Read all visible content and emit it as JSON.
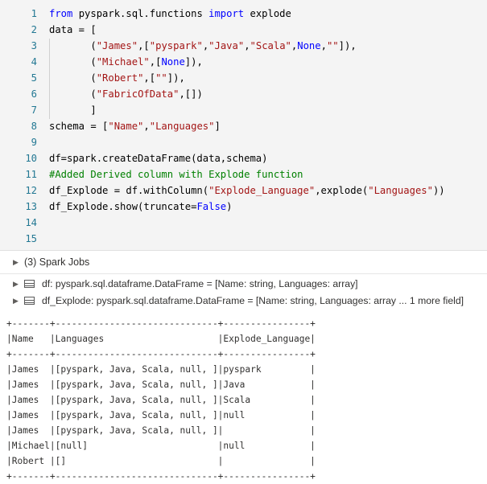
{
  "code_lines": [
    {
      "n": "1",
      "segs": [
        {
          "t": "from",
          "c": "kw"
        },
        {
          "t": " pyspark.sql.functions ",
          "c": "plain"
        },
        {
          "t": "import",
          "c": "kw"
        },
        {
          "t": " explode",
          "c": "plain"
        }
      ]
    },
    {
      "n": "2",
      "segs": [
        {
          "t": "data = [",
          "c": "plain"
        }
      ]
    },
    {
      "n": "3",
      "segs": [
        {
          "t": "       (",
          "c": "plain"
        },
        {
          "t": "\"James\"",
          "c": "str"
        },
        {
          "t": ",[",
          "c": "plain"
        },
        {
          "t": "\"pyspark\"",
          "c": "str"
        },
        {
          "t": ",",
          "c": "plain"
        },
        {
          "t": "\"Java\"",
          "c": "str"
        },
        {
          "t": ",",
          "c": "plain"
        },
        {
          "t": "\"Scala\"",
          "c": "str"
        },
        {
          "t": ",",
          "c": "plain"
        },
        {
          "t": "None",
          "c": "kw"
        },
        {
          "t": ",",
          "c": "plain"
        },
        {
          "t": "\"\"",
          "c": "str"
        },
        {
          "t": "]),",
          "c": "plain"
        }
      ]
    },
    {
      "n": "4",
      "segs": [
        {
          "t": "       (",
          "c": "plain"
        },
        {
          "t": "\"Michael\"",
          "c": "str"
        },
        {
          "t": ",[",
          "c": "plain"
        },
        {
          "t": "None",
          "c": "kw"
        },
        {
          "t": "]),",
          "c": "plain"
        }
      ]
    },
    {
      "n": "5",
      "segs": [
        {
          "t": "       (",
          "c": "plain"
        },
        {
          "t": "\"Robert\"",
          "c": "str"
        },
        {
          "t": ",[",
          "c": "plain"
        },
        {
          "t": "\"\"",
          "c": "str"
        },
        {
          "t": "]),",
          "c": "plain"
        }
      ]
    },
    {
      "n": "6",
      "segs": [
        {
          "t": "       (",
          "c": "plain"
        },
        {
          "t": "\"FabricOfData\"",
          "c": "str"
        },
        {
          "t": ",[])",
          "c": "plain"
        }
      ]
    },
    {
      "n": "7",
      "segs": [
        {
          "t": "       ]",
          "c": "plain"
        }
      ]
    },
    {
      "n": "8",
      "segs": [
        {
          "t": "schema = [",
          "c": "plain"
        },
        {
          "t": "\"Name\"",
          "c": "str"
        },
        {
          "t": ",",
          "c": "plain"
        },
        {
          "t": "\"Languages\"",
          "c": "str"
        },
        {
          "t": "]",
          "c": "plain"
        }
      ]
    },
    {
      "n": "9",
      "segs": []
    },
    {
      "n": "10",
      "segs": [
        {
          "t": "df=spark.createDataFrame(data,schema)",
          "c": "plain"
        }
      ]
    },
    {
      "n": "11",
      "segs": [
        {
          "t": "#Added Derived column with Explode function",
          "c": "cm"
        }
      ]
    },
    {
      "n": "12",
      "segs": [
        {
          "t": "df_Explode = df.withColumn(",
          "c": "plain"
        },
        {
          "t": "\"Explode_Language\"",
          "c": "str"
        },
        {
          "t": ",explode(",
          "c": "plain"
        },
        {
          "t": "\"Languages\"",
          "c": "str"
        },
        {
          "t": "))",
          "c": "plain"
        }
      ]
    },
    {
      "n": "13",
      "segs": [
        {
          "t": "df_Explode.show(truncate=",
          "c": "plain"
        },
        {
          "t": "False",
          "c": "kw"
        },
        {
          "t": ")",
          "c": "plain"
        }
      ]
    },
    {
      "n": "14",
      "segs": []
    },
    {
      "n": "15",
      "segs": []
    }
  ],
  "spark_jobs": {
    "label": "(3) Spark Jobs",
    "caret": "▶"
  },
  "dataframes": [
    {
      "caret": "▶",
      "text": "df:  pyspark.sql.dataframe.DataFrame = [Name: string, Languages: array]"
    },
    {
      "caret": "▶",
      "text": "df_Explode:  pyspark.sql.dataframe.DataFrame = [Name: string, Languages: array ... 1 more field]"
    }
  ],
  "output_lines": [
    "+-------+------------------------------+----------------+",
    "|Name   |Languages                     |Explode_Language|",
    "+-------+------------------------------+----------------+",
    "|James  |[pyspark, Java, Scala, null, ]|pyspark         |",
    "|James  |[pyspark, Java, Scala, null, ]|Java            |",
    "|James  |[pyspark, Java, Scala, null, ]|Scala           |",
    "|James  |[pyspark, Java, Scala, null, ]|null            |",
    "|James  |[pyspark, Java, Scala, null, ]|                |",
    "|Michael|[null]                        |null            |",
    "|Robert |[]                            |                |",
    "+-------+------------------------------+----------------+"
  ]
}
